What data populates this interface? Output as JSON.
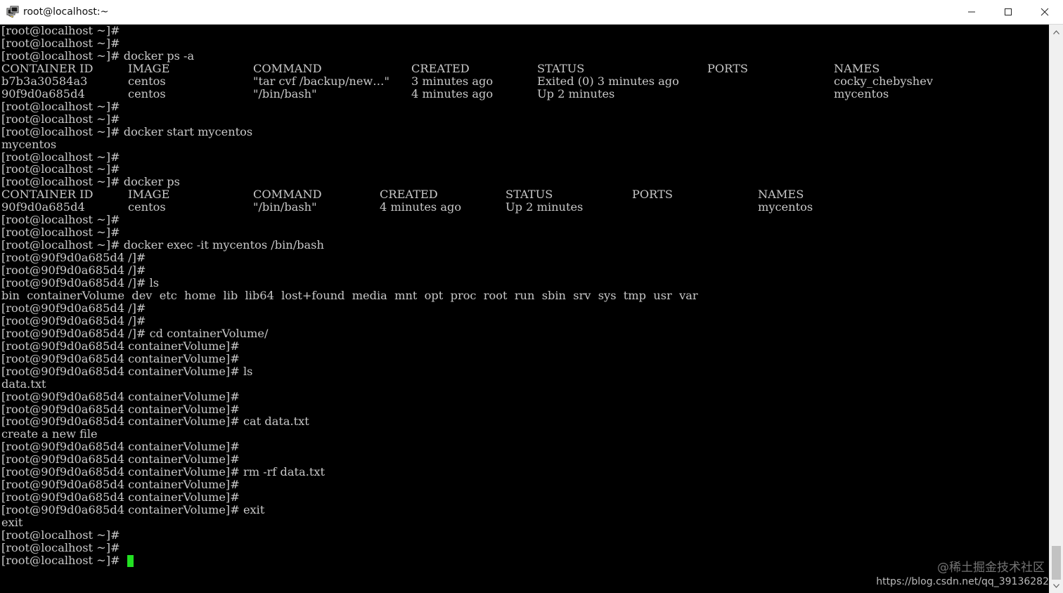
{
  "window": {
    "title": "root@localhost:~",
    "icon": "putty-terminal-icon",
    "controls": [
      "minimize",
      "maximize",
      "close"
    ]
  },
  "terminal": {
    "lines": [
      {
        "text": "[root@localhost ~]#"
      },
      {
        "text": "[root@localhost ~]#"
      },
      {
        "text": "[root@localhost ~]# docker ps -a"
      },
      {
        "cells": [
          "CONTAINER ID",
          "IMAGE",
          "COMMAND",
          "CREATED",
          "STATUS",
          "PORTS",
          "NAMES"
        ],
        "table": 1
      },
      {
        "cells": [
          "b7b3a30584a3",
          "centos",
          "\"tar cvf /backup/new…\"",
          "3 minutes ago",
          "Exited (0) 3 minutes ago",
          "",
          "cocky_chebyshev"
        ],
        "table": 1
      },
      {
        "cells": [
          "90f9d0a685d4",
          "centos",
          "\"/bin/bash\"",
          "4 minutes ago",
          "Up 2 minutes",
          "",
          "mycentos"
        ],
        "table": 1
      },
      {
        "text": "[root@localhost ~]#"
      },
      {
        "text": "[root@localhost ~]#"
      },
      {
        "text": "[root@localhost ~]# docker start mycentos"
      },
      {
        "text": "mycentos"
      },
      {
        "text": "[root@localhost ~]#"
      },
      {
        "text": "[root@localhost ~]#"
      },
      {
        "text": "[root@localhost ~]# docker ps"
      },
      {
        "cells": [
          "CONTAINER ID",
          "IMAGE",
          "COMMAND",
          "CREATED",
          "STATUS",
          "PORTS",
          "NAMES"
        ],
        "table": 2
      },
      {
        "cells": [
          "90f9d0a685d4",
          "centos",
          "\"/bin/bash\"",
          "4 minutes ago",
          "Up 2 minutes",
          "",
          "mycentos"
        ],
        "table": 2
      },
      {
        "text": "[root@localhost ~]#"
      },
      {
        "text": "[root@localhost ~]#"
      },
      {
        "text": "[root@localhost ~]# docker exec -it mycentos /bin/bash"
      },
      {
        "text": "[root@90f9d0a685d4 /]#"
      },
      {
        "text": "[root@90f9d0a685d4 /]#"
      },
      {
        "text": "[root@90f9d0a685d4 /]# ls"
      },
      {
        "text": "bin  containerVolume  dev  etc  home  lib  lib64  lost+found  media  mnt  opt  proc  root  run  sbin  srv  sys  tmp  usr  var"
      },
      {
        "text": "[root@90f9d0a685d4 /]#"
      },
      {
        "text": "[root@90f9d0a685d4 /]#"
      },
      {
        "text": "[root@90f9d0a685d4 /]# cd containerVolume/"
      },
      {
        "text": "[root@90f9d0a685d4 containerVolume]#"
      },
      {
        "text": "[root@90f9d0a685d4 containerVolume]#"
      },
      {
        "text": "[root@90f9d0a685d4 containerVolume]# ls"
      },
      {
        "text": "data.txt"
      },
      {
        "text": "[root@90f9d0a685d4 containerVolume]#"
      },
      {
        "text": "[root@90f9d0a685d4 containerVolume]#"
      },
      {
        "text": "[root@90f9d0a685d4 containerVolume]# cat data.txt"
      },
      {
        "text": "create a new file"
      },
      {
        "text": "[root@90f9d0a685d4 containerVolume]#"
      },
      {
        "text": "[root@90f9d0a685d4 containerVolume]#"
      },
      {
        "text": "[root@90f9d0a685d4 containerVolume]# rm -rf data.txt"
      },
      {
        "text": "[root@90f9d0a685d4 containerVolume]#"
      },
      {
        "text": "[root@90f9d0a685d4 containerVolume]#"
      },
      {
        "text": "[root@90f9d0a685d4 containerVolume]# exit"
      },
      {
        "text": "exit"
      },
      {
        "text": "[root@localhost ~]#"
      },
      {
        "text": "[root@localhost ~]#"
      },
      {
        "text": "[root@localhost ~]# ",
        "cursor": true
      }
    ],
    "text_color": "#c8c8c8",
    "background": "#000000",
    "cursor_color": "#22e022"
  },
  "watermark": {
    "line1": "@稀土掘金技术社区",
    "line2": "https://blog.csdn.net/qq_39136282"
  }
}
